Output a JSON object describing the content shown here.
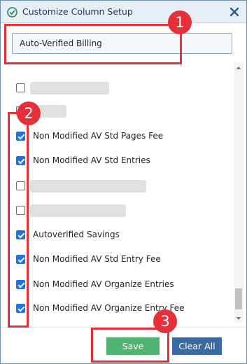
{
  "dialog": {
    "title": "Customize Column Setup",
    "icons": {
      "title": "checkmark-shield-icon",
      "close": "close-icon"
    }
  },
  "filter": {
    "value": "Auto-Verified Billing",
    "placeholder": ""
  },
  "columns": [
    {
      "label": "",
      "checked": false,
      "redacted": true
    },
    {
      "label": "",
      "checked": false,
      "redacted": true
    },
    {
      "label": "Non Modified AV Std Pages Fee",
      "checked": true,
      "redacted": false
    },
    {
      "label": "Non Modified AV Std Entries",
      "checked": true,
      "redacted": false
    },
    {
      "label": "",
      "checked": false,
      "redacted": true
    },
    {
      "label": "",
      "checked": false,
      "redacted": true
    },
    {
      "label": "Autoverified Savings",
      "checked": true,
      "redacted": false
    },
    {
      "label": "Non Modified AV Std Entry Fee",
      "checked": true,
      "redacted": false
    },
    {
      "label": "Non Modified AV Organize Entries",
      "checked": true,
      "redacted": false
    },
    {
      "label": "Non Modified AV Organize Entry Fee",
      "checked": true,
      "redacted": false
    }
  ],
  "footer": {
    "save_label": "Save",
    "clear_label": "Clear All"
  },
  "annotations": {
    "step1": "1",
    "step2": "2",
    "step3": "3"
  },
  "colors": {
    "highlight": "#e5303a",
    "save": "#4fb46f",
    "clear": "#3b6aa0",
    "checkbox": "#1a73e8"
  }
}
